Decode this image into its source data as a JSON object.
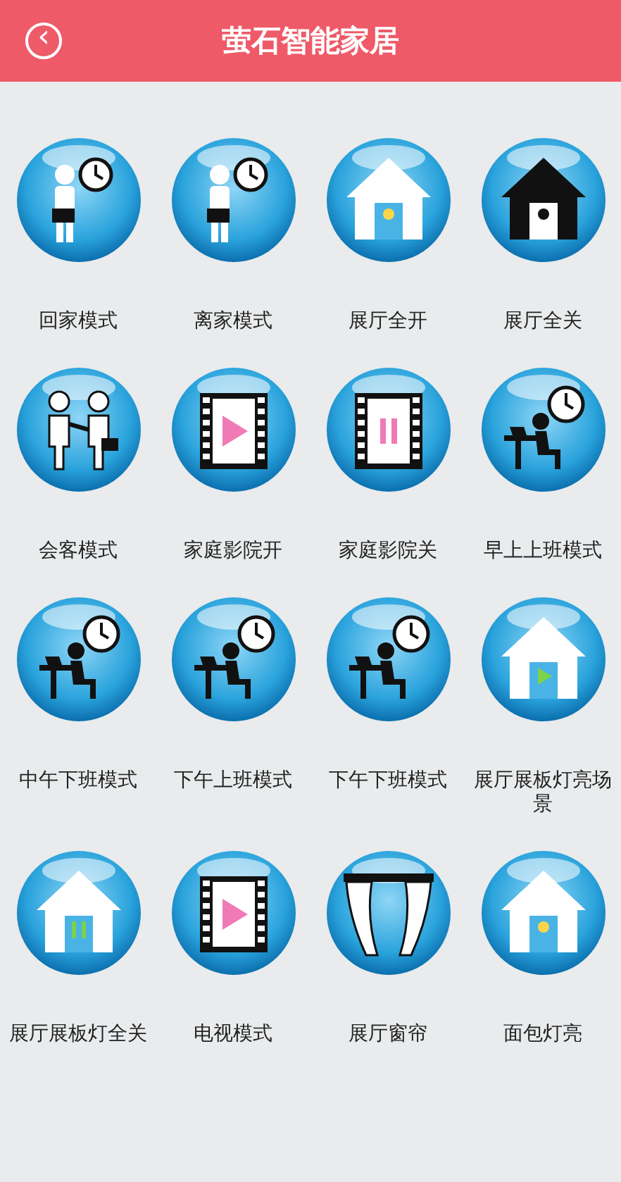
{
  "header": {
    "back": "‹",
    "title": "萤石智能家居"
  },
  "scenes": [
    {
      "label": "回家模式",
      "kind": "person-clock"
    },
    {
      "label": "离家模式",
      "kind": "person-clock"
    },
    {
      "label": "展厅全开",
      "kind": "house-lit"
    },
    {
      "label": "展厅全关",
      "kind": "house-dark"
    },
    {
      "label": "会客模式",
      "kind": "meeting"
    },
    {
      "label": "家庭影院开",
      "kind": "film-play"
    },
    {
      "label": "家庭影院关",
      "kind": "film-pause"
    },
    {
      "label": "早上上班模式",
      "kind": "desk-clock"
    },
    {
      "label": "中午下班模式",
      "kind": "desk-clock"
    },
    {
      "label": "下午上班模式",
      "kind": "desk-clock"
    },
    {
      "label": "下午下班模式",
      "kind": "desk-clock"
    },
    {
      "label": "展厅展板灯亮场景",
      "kind": "house-play"
    },
    {
      "label": "展厅展板灯全关",
      "kind": "house-pause"
    },
    {
      "label": "电视模式",
      "kind": "film-play"
    },
    {
      "label": "展厅窗帘",
      "kind": "curtain"
    },
    {
      "label": "面包灯亮",
      "kind": "house-lit"
    }
  ]
}
